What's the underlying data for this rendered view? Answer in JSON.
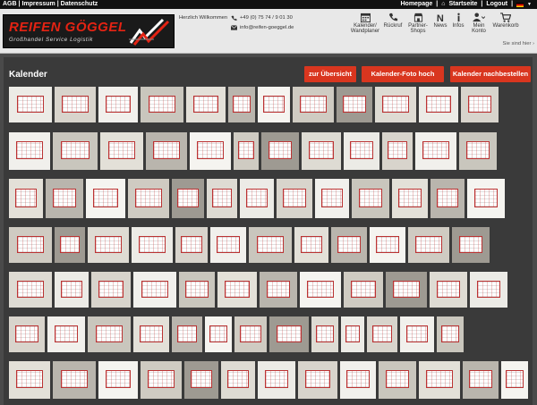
{
  "topbar": {
    "agb": "AGB",
    "impressum": "Impressum",
    "datenschutz": "Datenschutz",
    "sep": "|",
    "homepage": "Homepage",
    "startseite": "Startseite",
    "logout": "Logout"
  },
  "logo": {
    "brand": "REIFEN GÖGGEL",
    "tagline": "Großhandel Service Logistik"
  },
  "contact": {
    "welcome": "Herzlich Willkommen",
    "phone": "+49 (0) 75 74 / 9 01 30",
    "email": "info@reifen-goeggel.de"
  },
  "nav": [
    {
      "label": "Kalender/ Wandplaner",
      "icon": "calendar-icon"
    },
    {
      "label": "Rückruf",
      "icon": "phone-icon"
    },
    {
      "label": "Partner-Shops",
      "icon": "shop-icon"
    },
    {
      "label": "News",
      "icon": "news-icon"
    },
    {
      "label": "Infos",
      "icon": "info-icon"
    },
    {
      "label": "Mein Konto",
      "icon": "user-icon"
    },
    {
      "label": "Warenkorb",
      "icon": "cart-icon"
    }
  ],
  "sie_sind_hier": "Sie sind hier",
  "page": {
    "title": "Kalender",
    "buttons": {
      "overview": "zur Übersicht",
      "upload": "Kalender-Foto hoch laden",
      "reorder": "Kalender nachbestellen"
    }
  },
  "colors": {
    "accent": "#d9361f",
    "logo_red": "#e42313",
    "panel": "#3a3a3a"
  }
}
